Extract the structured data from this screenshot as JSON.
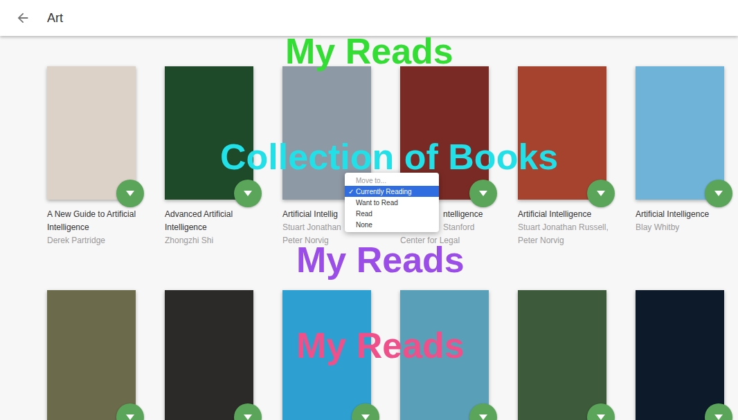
{
  "search": {
    "value": "Art"
  },
  "books": [
    {
      "kind": "normal",
      "title": "A New Guide to Artificial Intelligence",
      "authors": [
        "Derek Partridge"
      ],
      "color": "#dcd2c8"
    },
    {
      "kind": "normal",
      "title": "Advanced Artificial Intelligence",
      "authors": [
        "Zhongzhi Shi"
      ],
      "color": "#1f4a2a"
    },
    {
      "kind": "normal",
      "title": "Artificial Intellig",
      "authors": [
        "Stuart Jonathan",
        "Peter Norvig"
      ],
      "color": "#8e99a6"
    },
    {
      "kind": "partly-hidden",
      "title": "ntelligence",
      "authors": [
        "Stanford",
        "Center for Legal"
      ],
      "color": "#7a2a24"
    },
    {
      "kind": "normal",
      "title": "Artificial Intelligence",
      "authors": [
        "Stuart Jonathan Russell,",
        "Peter Norvig"
      ],
      "color": "#a5432f"
    },
    {
      "kind": "normal",
      "title": "Artificial Intelligence",
      "authors": [
        "Blay Whitby"
      ],
      "color": "#6fb3d8"
    },
    {
      "kind": "cover-only",
      "authors": [],
      "color": "#6b6a4a"
    },
    {
      "kind": "cover-only",
      "authors": [],
      "color": "#2c2a28"
    },
    {
      "kind": "cover-only",
      "authors": [],
      "color": "#2d9fd0"
    },
    {
      "kind": "cover-only",
      "authors": [],
      "color": "#5a9fb8"
    },
    {
      "kind": "cover-only",
      "authors": [],
      "color": "#3d5a3a"
    },
    {
      "kind": "cover-only",
      "authors": [],
      "color": "#0d1a2a"
    }
  ],
  "menu": {
    "check_mark": "✓",
    "items": [
      {
        "label": "Move to...",
        "disabled": true,
        "checked": false,
        "selected": false
      },
      {
        "label": "Currently Reading",
        "disabled": false,
        "checked": true,
        "selected": true
      },
      {
        "label": "Want to Read",
        "disabled": false,
        "checked": false,
        "selected": false
      },
      {
        "label": "Read",
        "disabled": false,
        "checked": false,
        "selected": false
      },
      {
        "label": "None",
        "disabled": false,
        "checked": false,
        "selected": false
      }
    ]
  },
  "overlays": [
    {
      "text": "My Reads",
      "color": "#33dd33"
    },
    {
      "text": "Collection of Books",
      "color": "#22e0e8"
    },
    {
      "text": "My Reads",
      "color": "#9b4de8"
    },
    {
      "text": "My Reads",
      "color": "#f0508a"
    }
  ]
}
